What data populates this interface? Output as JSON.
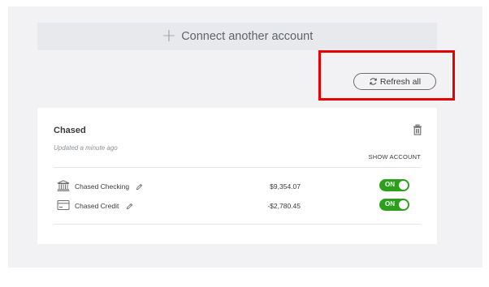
{
  "connect": {
    "label": "Connect another account"
  },
  "refresh": {
    "label": "Refresh all"
  },
  "bank_card": {
    "title": "Chased",
    "updated": "Updated a minute ago",
    "show_account_header": "SHOW ACCOUNT",
    "accounts": [
      {
        "icon": "bank-icon",
        "name": "Chased Checking",
        "amount": "$9,354.07",
        "toggle": "ON"
      },
      {
        "icon": "credit-card-icon",
        "name": "Chased Credit",
        "amount": "-$2,780.45",
        "toggle": "ON"
      }
    ]
  },
  "colors": {
    "toggle_on": "#2ca01c",
    "highlight": "#e60000",
    "page_bg": "#f2f2f5"
  }
}
